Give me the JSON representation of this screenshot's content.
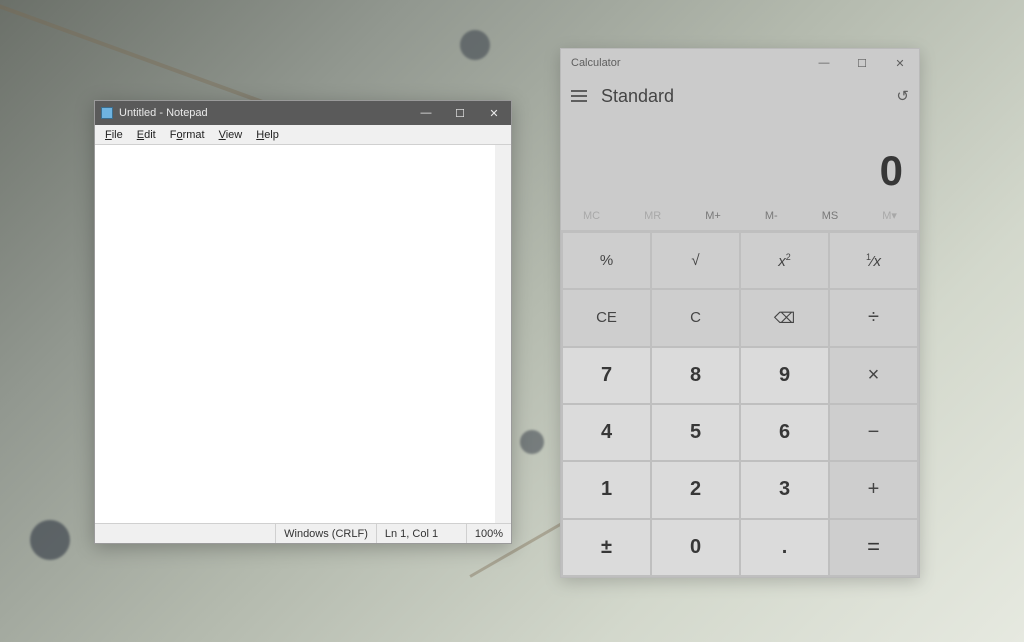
{
  "notepad": {
    "title": "Untitled - Notepad",
    "menu": {
      "file": "File",
      "edit": "Edit",
      "format": "Format",
      "view": "View",
      "help": "Help"
    },
    "content": "",
    "status": {
      "encoding": "Windows (CRLF)",
      "position": "Ln 1, Col 1",
      "zoom": "100%"
    }
  },
  "calculator": {
    "title": "Calculator",
    "mode": "Standard",
    "display": "0",
    "memory": {
      "mc": "MC",
      "mr": "MR",
      "mplus": "M+",
      "mminus": "M-",
      "ms": "MS",
      "mlist": "M▾"
    },
    "keys": {
      "percent": "%",
      "sqrt": "√",
      "sqr": "x²",
      "recip": "¹⁄x",
      "ce": "CE",
      "c": "C",
      "back": "⌫",
      "div": "÷",
      "k7": "7",
      "k8": "8",
      "k9": "9",
      "mul": "×",
      "k4": "4",
      "k5": "5",
      "k6": "6",
      "sub": "−",
      "k1": "1",
      "k2": "2",
      "k3": "3",
      "add": "+",
      "neg": "±",
      "k0": "0",
      "dot": ".",
      "eq": "="
    }
  }
}
